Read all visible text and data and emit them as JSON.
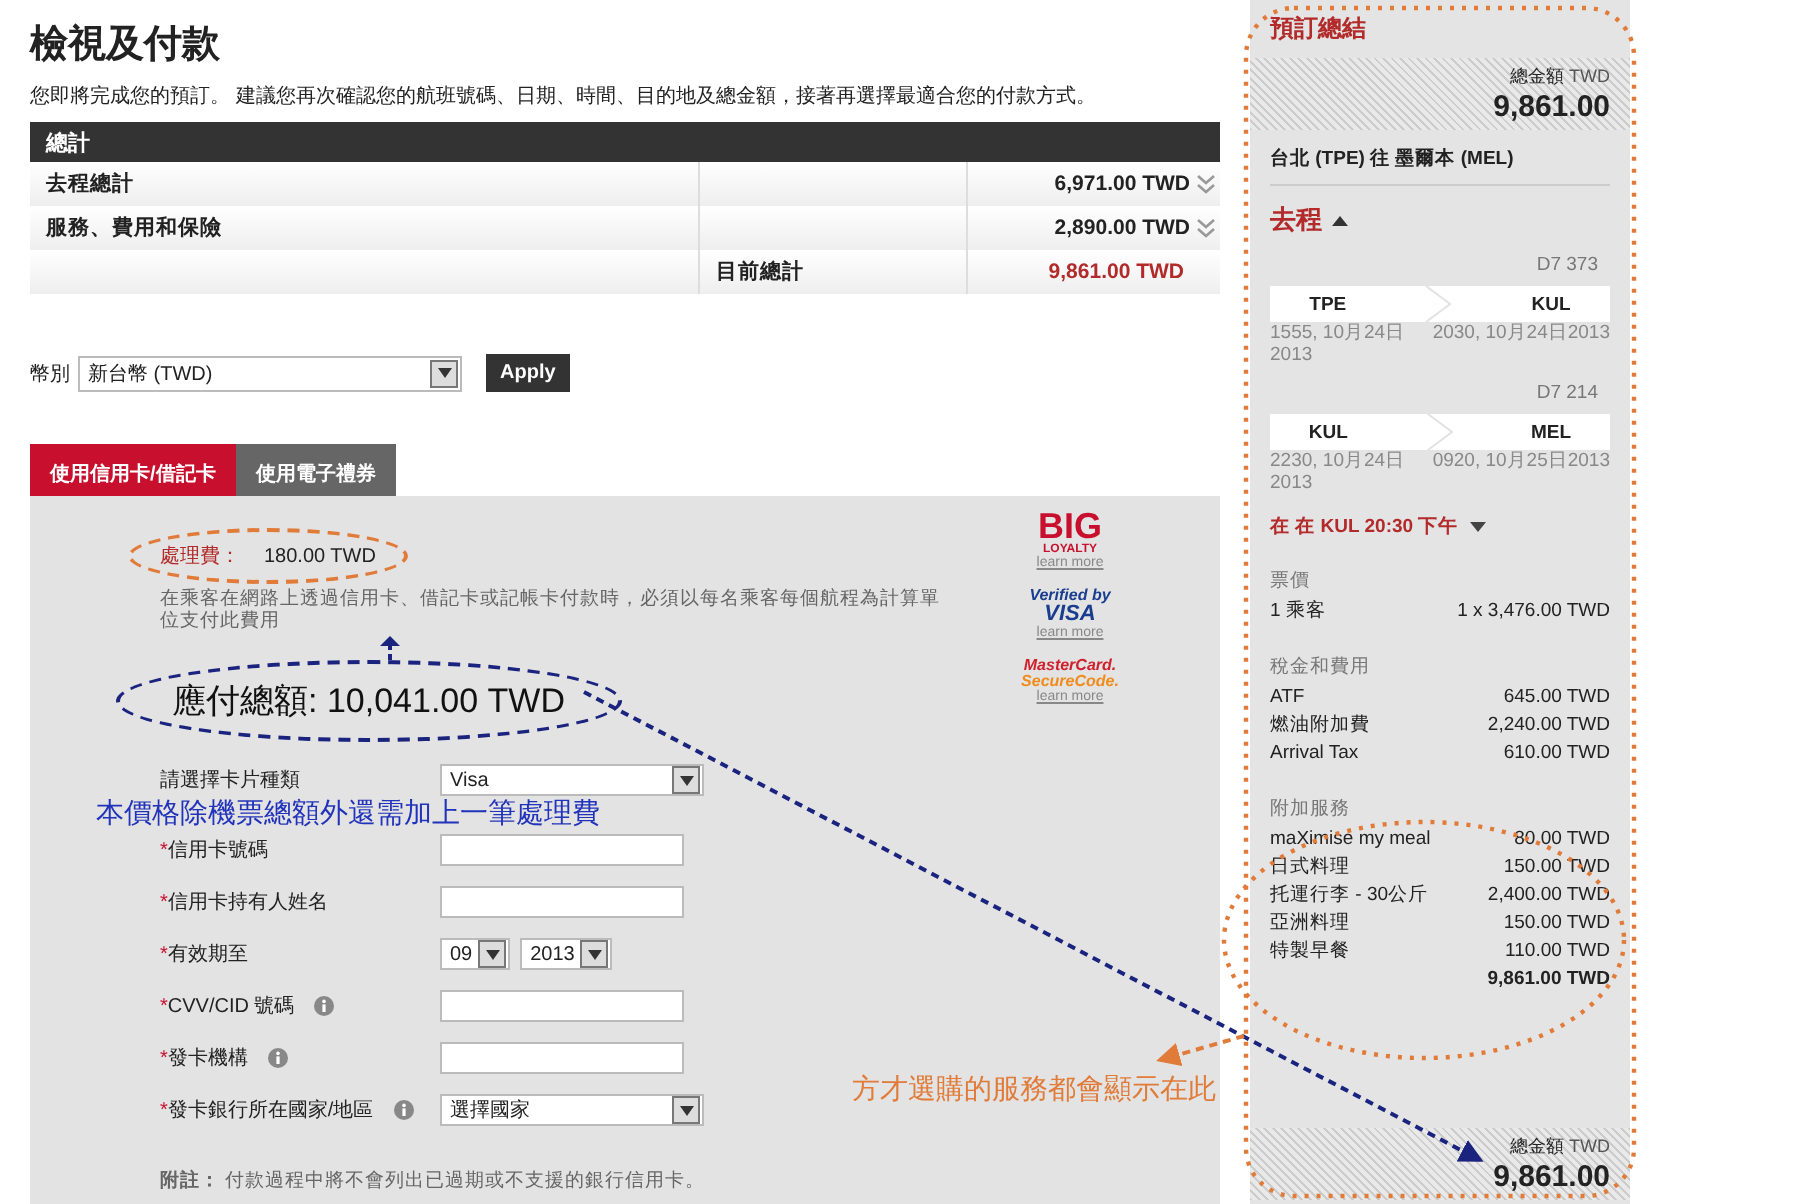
{
  "page": {
    "title": "檢視及付款",
    "intro": "您即將完成您的預訂。 建議您再次確認您的航班號碼、日期、時間、目的地及總金額，接著再選擇最適合您的付款方式。"
  },
  "summary": {
    "header": "總計",
    "rows": [
      {
        "kind": "item",
        "label": "去程總計",
        "amount": "6,971.00 TWD"
      },
      {
        "kind": "item",
        "label": "服務、費用和保險",
        "amount": "2,890.00 TWD"
      },
      {
        "kind": "total",
        "label": "目前總計",
        "amount": "9,861.00 TWD"
      }
    ]
  },
  "currency": {
    "label": "幣別",
    "value": "新台幣 (TWD)",
    "button": "Apply"
  },
  "payment_tabs": [
    {
      "label": "使用信用卡/借記卡",
      "selected": true
    },
    {
      "label": "使用電子禮券",
      "selected": false
    }
  ],
  "fee": {
    "label": "處理費：",
    "amount": "180.00 TWD",
    "note": "在乘客在網路上透過信用卡、借記卡或記帳卡付款時，必須以每名乘客每個航程為計算單位支付此費用"
  },
  "badges": [
    {
      "kind": "big",
      "lines": [
        "BIG",
        "LOYALTY"
      ],
      "link": "learn more"
    },
    {
      "kind": "visa",
      "lines": [
        "Verified by",
        "VISA"
      ],
      "link": "learn more"
    },
    {
      "kind": "mastercard",
      "lines": [
        "MasterCard.",
        "SecureCode."
      ],
      "link": "learn more"
    }
  ],
  "callout": "應付總額:  10,041.00 TWD",
  "form": {
    "fields": [
      {
        "kind": "select",
        "label": "請選擇卡片種類",
        "value": "Visa",
        "info": false
      },
      {
        "kind": "note",
        "label": "本價格除機票總額外還需加上一筆處理費"
      },
      {
        "kind": "input",
        "mark": "*",
        "label": "信用卡號碼",
        "info": false
      },
      {
        "kind": "input",
        "mark": "*",
        "label": "信用卡持有人姓名",
        "info": false
      },
      {
        "kind": "date",
        "mark": "*",
        "label": "有效期至",
        "values": [
          "09",
          "2013"
        ],
        "info": false
      },
      {
        "kind": "input",
        "mark": "*",
        "label": "CVV/CID 號碼",
        "info": true
      },
      {
        "kind": "input",
        "mark": "*",
        "label": "發卡機構",
        "info": true
      },
      {
        "kind": "select",
        "mark": "*",
        "label": "發卡銀行所在國家/地區",
        "value": "選擇國家",
        "info": true
      }
    ],
    "note_label": "附註：",
    "note": "付款過程中將不會列出已過期或不支援的銀行信用卡。"
  },
  "side_note": "方才選購的服務都會顯示在此",
  "sidebar": {
    "title": "預訂總結",
    "total_label": "總金額",
    "currency": "TWD",
    "total": "9,861.00",
    "route": "台北 (TPE) 往 墨爾本 (MEL)",
    "leg": {
      "label": "去程",
      "expanded": true
    },
    "flights": [
      {
        "number": "D7 373",
        "from": "TPE",
        "to": "KUL",
        "depart": "1555, 10月24日 2013",
        "arrive": "2030, 10月24日2013"
      },
      {
        "number": "D7 214",
        "from": "KUL",
        "to": "MEL",
        "depart": "2230, 10月24日 2013",
        "arrive": "0920, 10月25日2013"
      }
    ],
    "stopover": {
      "text": "在 在 KUL 20:30 下午",
      "expanded": false
    },
    "sections": [
      {
        "title": "票價",
        "items": [
          {
            "label": "1 乘客",
            "amount": "1 x 3,476.00 TWD"
          }
        ]
      },
      {
        "title": "稅金和費用",
        "items": [
          {
            "label": "ATF",
            "amount": "645.00 TWD"
          },
          {
            "label": "燃油附加費",
            "amount": "2,240.00 TWD"
          },
          {
            "label": "Arrival Tax",
            "amount": "610.00 TWD"
          }
        ]
      },
      {
        "title": "附加服務",
        "items": [
          {
            "label": "maXimise my meal",
            "amount": "80.00 TWD"
          },
          {
            "label": "日式料理",
            "amount": "150.00 TWD"
          },
          {
            "label": "托運行李 - 30公斤",
            "amount": "2,400.00 TWD"
          },
          {
            "label": "亞洲料理",
            "amount": "150.00 TWD"
          },
          {
            "label": "特製早餐",
            "amount": "110.00 TWD"
          }
        ],
        "subtotal": "9,861.00 TWD"
      }
    ],
    "bottom_total": {
      "label": "總金額",
      "currency": "TWD",
      "total": "9,861.00"
    }
  }
}
